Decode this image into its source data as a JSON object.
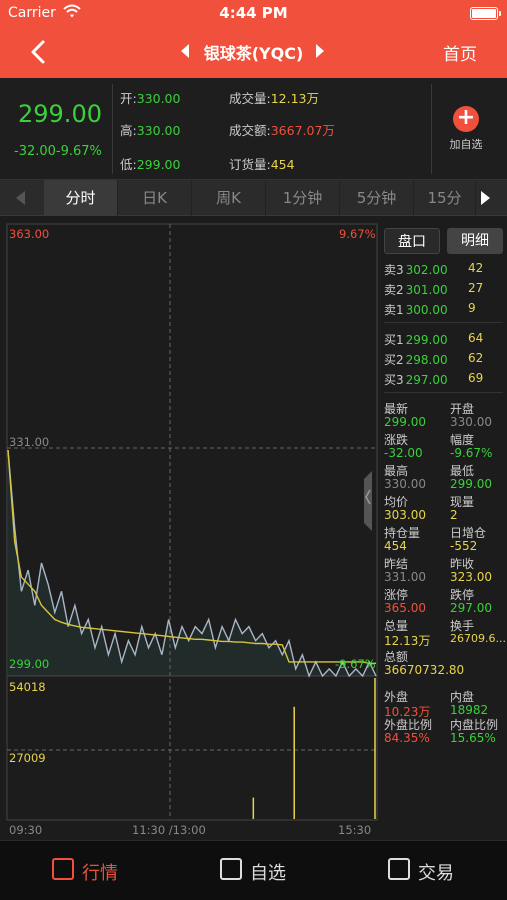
{
  "status": {
    "carrier": "Carrier",
    "time": "4:44 PM"
  },
  "nav": {
    "title": "银球茶(YQC)",
    "home": "首页"
  },
  "quote": {
    "price": "299.00",
    "change": "-32.00-9.67%",
    "open_label": "开:",
    "open": "330.00",
    "high_label": "高:",
    "high": "330.00",
    "low_label": "低:",
    "low": "299.00",
    "volume_label": "成交量:",
    "volume": "12.13万",
    "amount_label": "成交额:",
    "amount": "3667.07万",
    "order_label": "订货量:",
    "order": "454",
    "add_label": "加自选"
  },
  "tabs": [
    "分时",
    "日K",
    "周K",
    "1分钟",
    "5分钟",
    "15分"
  ],
  "chart": {
    "y_top": "363.00",
    "y_mid": "331.00",
    "y_bottom": "299.00",
    "pct_top": "9.67%",
    "pct_bottom": "-9.67%",
    "vol_top": "54018",
    "vol_mid": "27009",
    "x_start": "09:30",
    "x_mid": "11:30 /13:00",
    "x_end": "15:30"
  },
  "chart_data": {
    "type": "line",
    "title": "",
    "x": [
      "09:30",
      "11:30/13:00",
      "15:30"
    ],
    "ylim": [
      299.0,
      363.0
    ],
    "series": [
      {
        "name": "",
        "color": "#a9b6c8",
        "values": [
          331,
          320,
          311,
          314,
          309,
          315,
          312,
          308,
          311,
          306,
          309,
          305,
          307,
          303,
          306,
          302,
          305,
          301,
          304,
          302,
          306,
          303,
          305,
          302,
          307,
          303,
          306,
          304,
          306,
          305,
          307,
          303,
          306,
          304,
          307,
          305,
          306,
          304,
          305,
          303,
          304,
          302,
          304,
          300,
          302,
          299,
          301,
          299,
          300,
          299,
          301,
          299,
          300,
          299,
          301,
          299
        ]
      },
      {
        "name": "",
        "color": "#d7c43a",
        "values": [
          331,
          318,
          313,
          312,
          311,
          309,
          308,
          307,
          306.6,
          306.3,
          306.1,
          305.9,
          305.8,
          305.7,
          305.6,
          305.5,
          305.4,
          305.3,
          305.2,
          305.1,
          305.0,
          304.9,
          304.8,
          304.7,
          304.6,
          304.5,
          304.4,
          304.3,
          304.2,
          304.2,
          304.1,
          304.0,
          303.9,
          303.9,
          303.8,
          303.8,
          303.7,
          303.6,
          303.6,
          303.5,
          303.5,
          303.4,
          301,
          301,
          301,
          301,
          301,
          301,
          301,
          301,
          301,
          301,
          301,
          301,
          300.8,
          300.8
        ]
      }
    ],
    "volume": {
      "ylim": [
        0,
        54018
      ],
      "spikes": [
        {
          "x": "13:30",
          "value": 8200
        },
        {
          "x": "14:10",
          "value": 43000
        },
        {
          "x": "15:30",
          "value": 54018
        }
      ]
    }
  },
  "side": {
    "tab_active": "盘口",
    "tab_other": "明细",
    "asks": [
      {
        "label": "卖3",
        "price": "302.00",
        "vol": "42"
      },
      {
        "label": "卖2",
        "price": "301.00",
        "vol": "27"
      },
      {
        "label": "卖1",
        "price": "300.00",
        "vol": "9"
      }
    ],
    "bids": [
      {
        "label": "买1",
        "price": "299.00",
        "vol": "64"
      },
      {
        "label": "买2",
        "price": "298.00",
        "vol": "62"
      },
      {
        "label": "买3",
        "price": "297.00",
        "vol": "69"
      }
    ],
    "latest_label": "最新",
    "latest": "299.00",
    "open_label": "开盘",
    "open": "330.00",
    "chg_label": "涨跌",
    "chg": "-32.00",
    "amp_label": "幅度",
    "amp": "-9.67%",
    "high_label": "最高",
    "high": "330.00",
    "low_label": "最低",
    "low": "299.00",
    "avg_label": "均价",
    "avg": "303.00",
    "cur_label": "现量",
    "cur": "2",
    "pos_label": "持仓量",
    "pos": "454",
    "daily_label": "日增仓",
    "daily": "-552",
    "prevset_label": "昨结",
    "prevset": "331.00",
    "prevclose_label": "昨收",
    "prevclose": "323.00",
    "limitup_label": "涨停",
    "limitup": "365.00",
    "limitdown_label": "跌停",
    "limitdown": "297.00",
    "totvol_label": "总量",
    "totvol": "12.13万",
    "turnover_label": "换手",
    "turnover": "26709.6...",
    "totamt_label": "总额",
    "totamt": "36670732.80",
    "outer_label": "外盘",
    "outer": "10.23万",
    "inner_label": "内盘",
    "inner": "18982",
    "outer_ratio_label": "外盘比例",
    "outer_ratio": "84.35%",
    "inner_ratio_label": "内盘比例",
    "inner_ratio": "15.65%"
  },
  "tabbar": {
    "market": "行情",
    "watch": "自选",
    "trade": "交易"
  },
  "colors": {
    "accent": "#f0503c",
    "down": "#3ad13a",
    "volume": "#e8d44a",
    "price_line": "#a9b6c8",
    "avg_line": "#d7c43a"
  }
}
